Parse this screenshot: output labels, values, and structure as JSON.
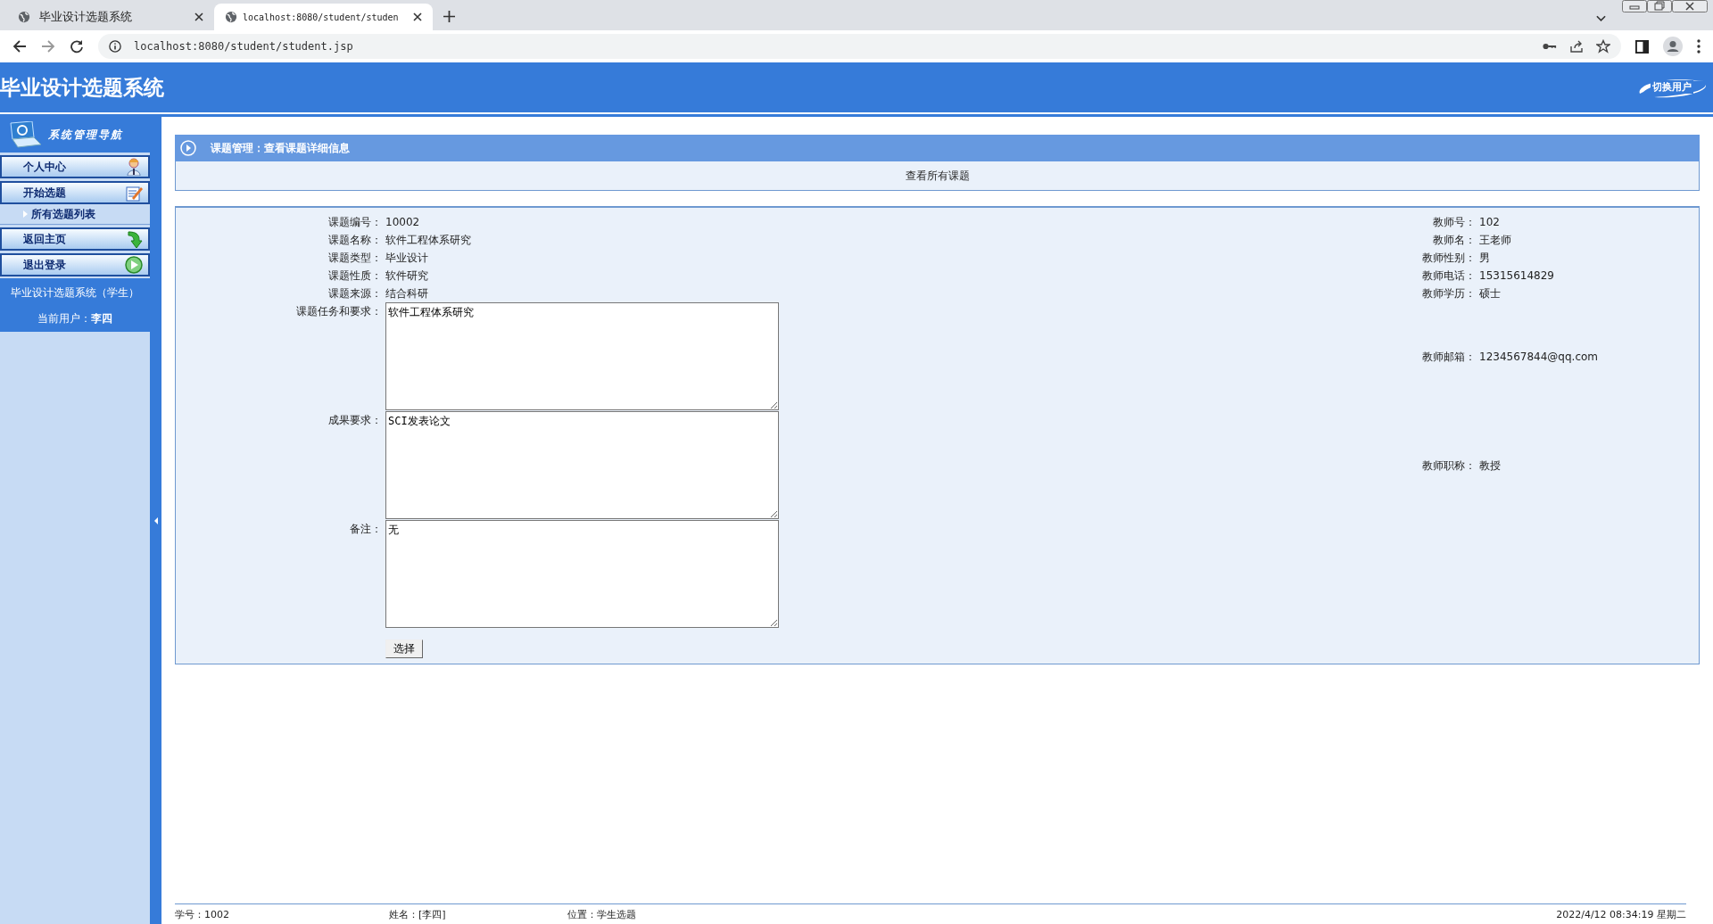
{
  "browser": {
    "tabs": [
      {
        "title": "毕业设计选题系统",
        "selected": false
      },
      {
        "title": "localhost:8080/student/studen",
        "selected": true
      }
    ],
    "address": "localhost:8080/student/student.jsp"
  },
  "header": {
    "title": "毕业设计选题系统",
    "switch_user": "切换用户"
  },
  "sidebar": {
    "title": "系统管理导航",
    "items": [
      {
        "label": "个人中心",
        "kind": "main"
      },
      {
        "label": "开始选题",
        "kind": "main"
      },
      {
        "label": "所有选题列表",
        "kind": "sub"
      },
      {
        "label": "返回主页",
        "kind": "main"
      },
      {
        "label": "退出登录",
        "kind": "main"
      }
    ],
    "system": "毕业设计选题系统（学生）",
    "user": "当前用户：**李四**"
  },
  "panel": {
    "title": "课题管理：查看课题详细信息",
    "link": "查看所有课题"
  },
  "topic": [
    {
      "label": "课题编号：",
      "value": "10002"
    },
    {
      "label": "课题名称：",
      "value": "软件工程体系研究"
    },
    {
      "label": "课题类型：",
      "value": "毕业设计"
    },
    {
      "label": "课题性质：",
      "value": "软件研究"
    },
    {
      "label": "课题来源：",
      "value": "结合科研"
    }
  ],
  "topic_text": [
    {
      "label": "课题任务和要求：",
      "value": "软件工程体系研究"
    },
    {
      "label": "成果要求：",
      "value": "SCI发表论文"
    },
    {
      "label": "备注：",
      "value": "无"
    }
  ],
  "teacher": [
    {
      "label": "教师号：",
      "value": "102"
    },
    {
      "label": "教师名：",
      "value": "王老师"
    },
    {
      "label": "教师性别：",
      "value": "男"
    },
    {
      "label": "教师电话：",
      "value": "15315614829"
    },
    {
      "label": "教师学历：",
      "value": "硕士"
    }
  ],
  "teacher_extra": [
    {
      "label": "教师邮箱：",
      "value": "1234567844@qq.com"
    },
    {
      "label": "教师职称：",
      "value": "教授"
    }
  ],
  "button": "选择",
  "footer": {
    "student_id": "学号：1002",
    "name": "姓名：[李四]",
    "location": "位置：学生选题",
    "datetime": "2022/4/12 08:34:19 星期二"
  }
}
